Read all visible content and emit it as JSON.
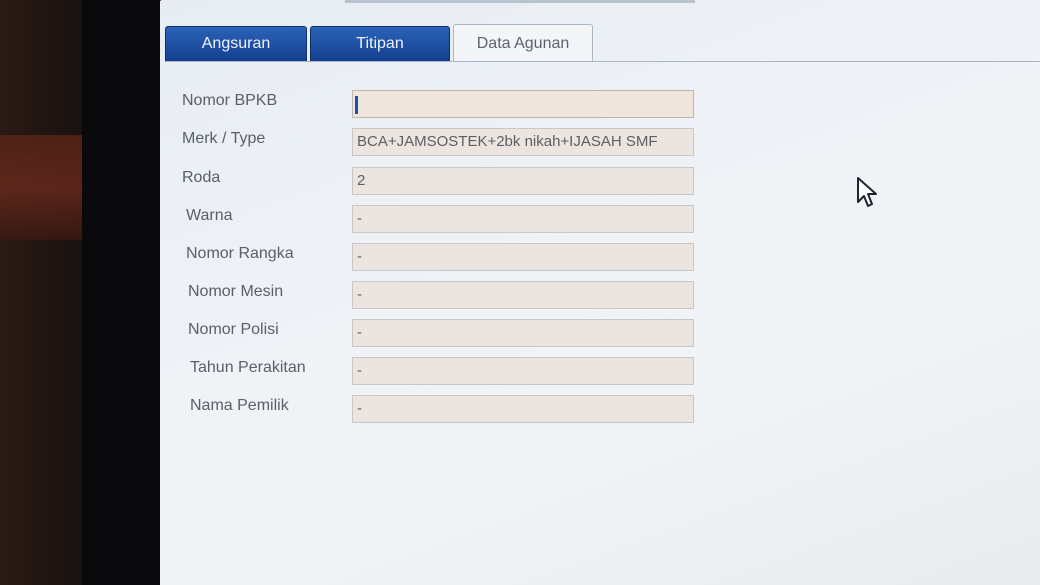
{
  "tabs": [
    {
      "label": "Angsuran",
      "active": false
    },
    {
      "label": "Titipan",
      "active": false
    },
    {
      "label": "Data Agunan",
      "active": true
    }
  ],
  "form": {
    "fields": [
      {
        "label": "Nomor BPKB",
        "value": ""
      },
      {
        "label": "Merk / Type",
        "value": "BCA+JAMSOSTEK+2bk nikah+IJASAH SMF"
      },
      {
        "label": "Roda",
        "value": "2"
      },
      {
        "label": "Warna",
        "value": "-"
      },
      {
        "label": "Nomor Rangka",
        "value": "-"
      },
      {
        "label": "Nomor Mesin",
        "value": "-"
      },
      {
        "label": "Nomor Polisi",
        "value": "-"
      },
      {
        "label": "Tahun Perakitan",
        "value": "-"
      },
      {
        "label": "Nama Pemilik",
        "value": "-"
      }
    ]
  },
  "colors": {
    "tab_dark": "#1f4fa0",
    "screen_bg": "#eef2f6",
    "field_bg": "#ece5df"
  },
  "icons": {
    "pointer": "mouse-pointer-icon"
  }
}
